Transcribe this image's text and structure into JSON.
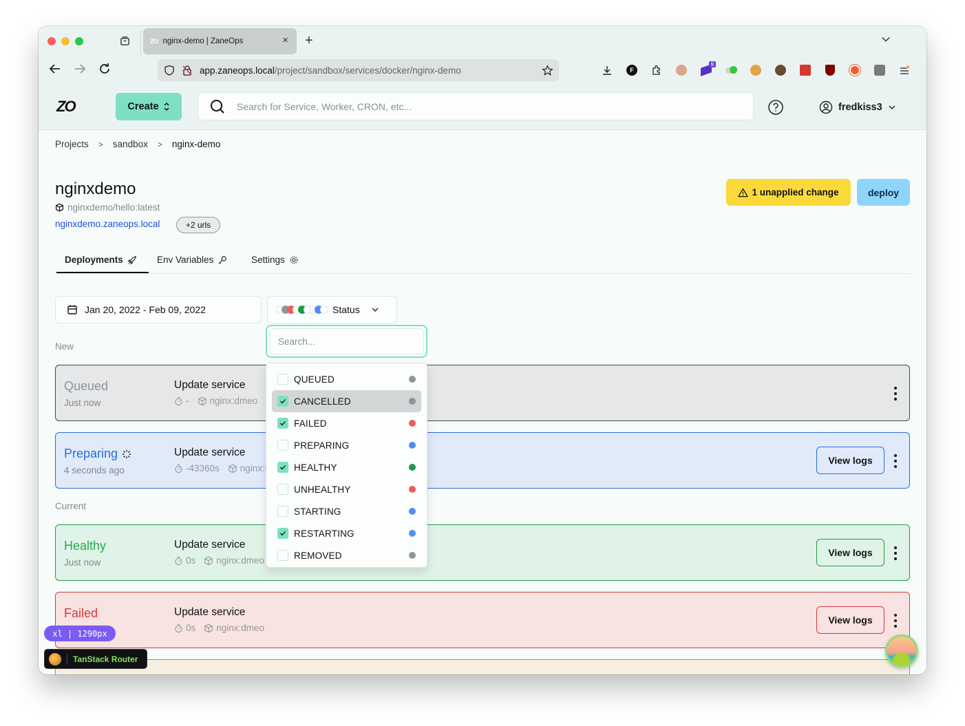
{
  "browser": {
    "tab_title": "nginx-demo | ZaneOps",
    "tab_favicon": "ZO",
    "url_host": "app.zaneops.local",
    "url_path": "/project/sandbox/services/docker/nginx-demo",
    "extensions": [
      "download-icon",
      "f-extension-icon",
      "puzzle-icon",
      "avatar-extension-icon",
      "stack-extension-icon",
      "toggle-extension-icon",
      "cookie-icon",
      "cookie-bite-icon",
      "react-devtools-icon",
      "ublock-icon",
      "duckduckgo-icon",
      "bitwarden-icon",
      "menu-icon"
    ],
    "stack_badge": "9"
  },
  "header": {
    "logo": "ZO",
    "create_label": "Create",
    "search_placeholder": "Search for Service, Worker, CRON, etc...",
    "username": "fredkiss3"
  },
  "breadcrumb": [
    "Projects",
    "sandbox",
    "nginx-demo"
  ],
  "service": {
    "title": "nginxdemo",
    "image": "nginxdemo/hello:latest",
    "url": "nginxdemo.zaneops.local",
    "extra_urls": "+2 urls",
    "unapplied_label": "1 unapplied change",
    "deploy_label": "deploy"
  },
  "tabs": [
    {
      "label": "Deployments",
      "icon": "rocket-icon",
      "active": true
    },
    {
      "label": "Env Variables",
      "icon": "key-icon",
      "active": false
    },
    {
      "label": "Settings",
      "icon": "gear-icon",
      "active": false
    }
  ],
  "filters": {
    "date_range": "Jan 20, 2022 - Feb 09, 2022",
    "status_label": "Status",
    "search_placeholder": "Search..."
  },
  "status_options": [
    {
      "label": "QUEUED",
      "checked": false,
      "color": "#8f959b",
      "highlighted": false
    },
    {
      "label": "CANCELLED",
      "checked": true,
      "color": "#8f959b",
      "highlighted": true
    },
    {
      "label": "FAILED",
      "checked": true,
      "color": "#ef5a5a",
      "highlighted": false
    },
    {
      "label": "PREPARING",
      "checked": false,
      "color": "#4f8ff0",
      "highlighted": false
    },
    {
      "label": "HEALTHY",
      "checked": true,
      "color": "#1d9a46",
      "highlighted": false
    },
    {
      "label": "UNHEALTHY",
      "checked": false,
      "color": "#ef5a5a",
      "highlighted": false
    },
    {
      "label": "STARTING",
      "checked": false,
      "color": "#4f8ff0",
      "highlighted": false
    },
    {
      "label": "RESTARTING",
      "checked": true,
      "color": "#4f8ff0",
      "highlighted": false
    },
    {
      "label": "REMOVED",
      "checked": false,
      "color": "#8f959b",
      "highlighted": false
    }
  ],
  "sections": {
    "new": "New",
    "current": "Current"
  },
  "deployments": [
    {
      "status": "Queued",
      "when": "Just now",
      "message": "Update service",
      "duration": "-",
      "image": "nginx:dmeo",
      "view_logs": null
    },
    {
      "status": "Preparing",
      "when": "4 seconds ago",
      "message": "Update service",
      "duration": "-43360s",
      "image": "nginx:dmeo",
      "view_logs": "View logs"
    },
    {
      "status": "Healthy",
      "when": "Just now",
      "message": "Update service",
      "duration": "0s",
      "image": "nginx:dmeo",
      "view_logs": "View logs"
    },
    {
      "status": "Failed",
      "when": "",
      "message": "Update service",
      "duration": "0s",
      "image": "nginx:dmeo",
      "view_logs": "View logs"
    }
  ],
  "devtools": {
    "breakpoint": "xl | 1290px",
    "router_label": "TanStack Router"
  }
}
